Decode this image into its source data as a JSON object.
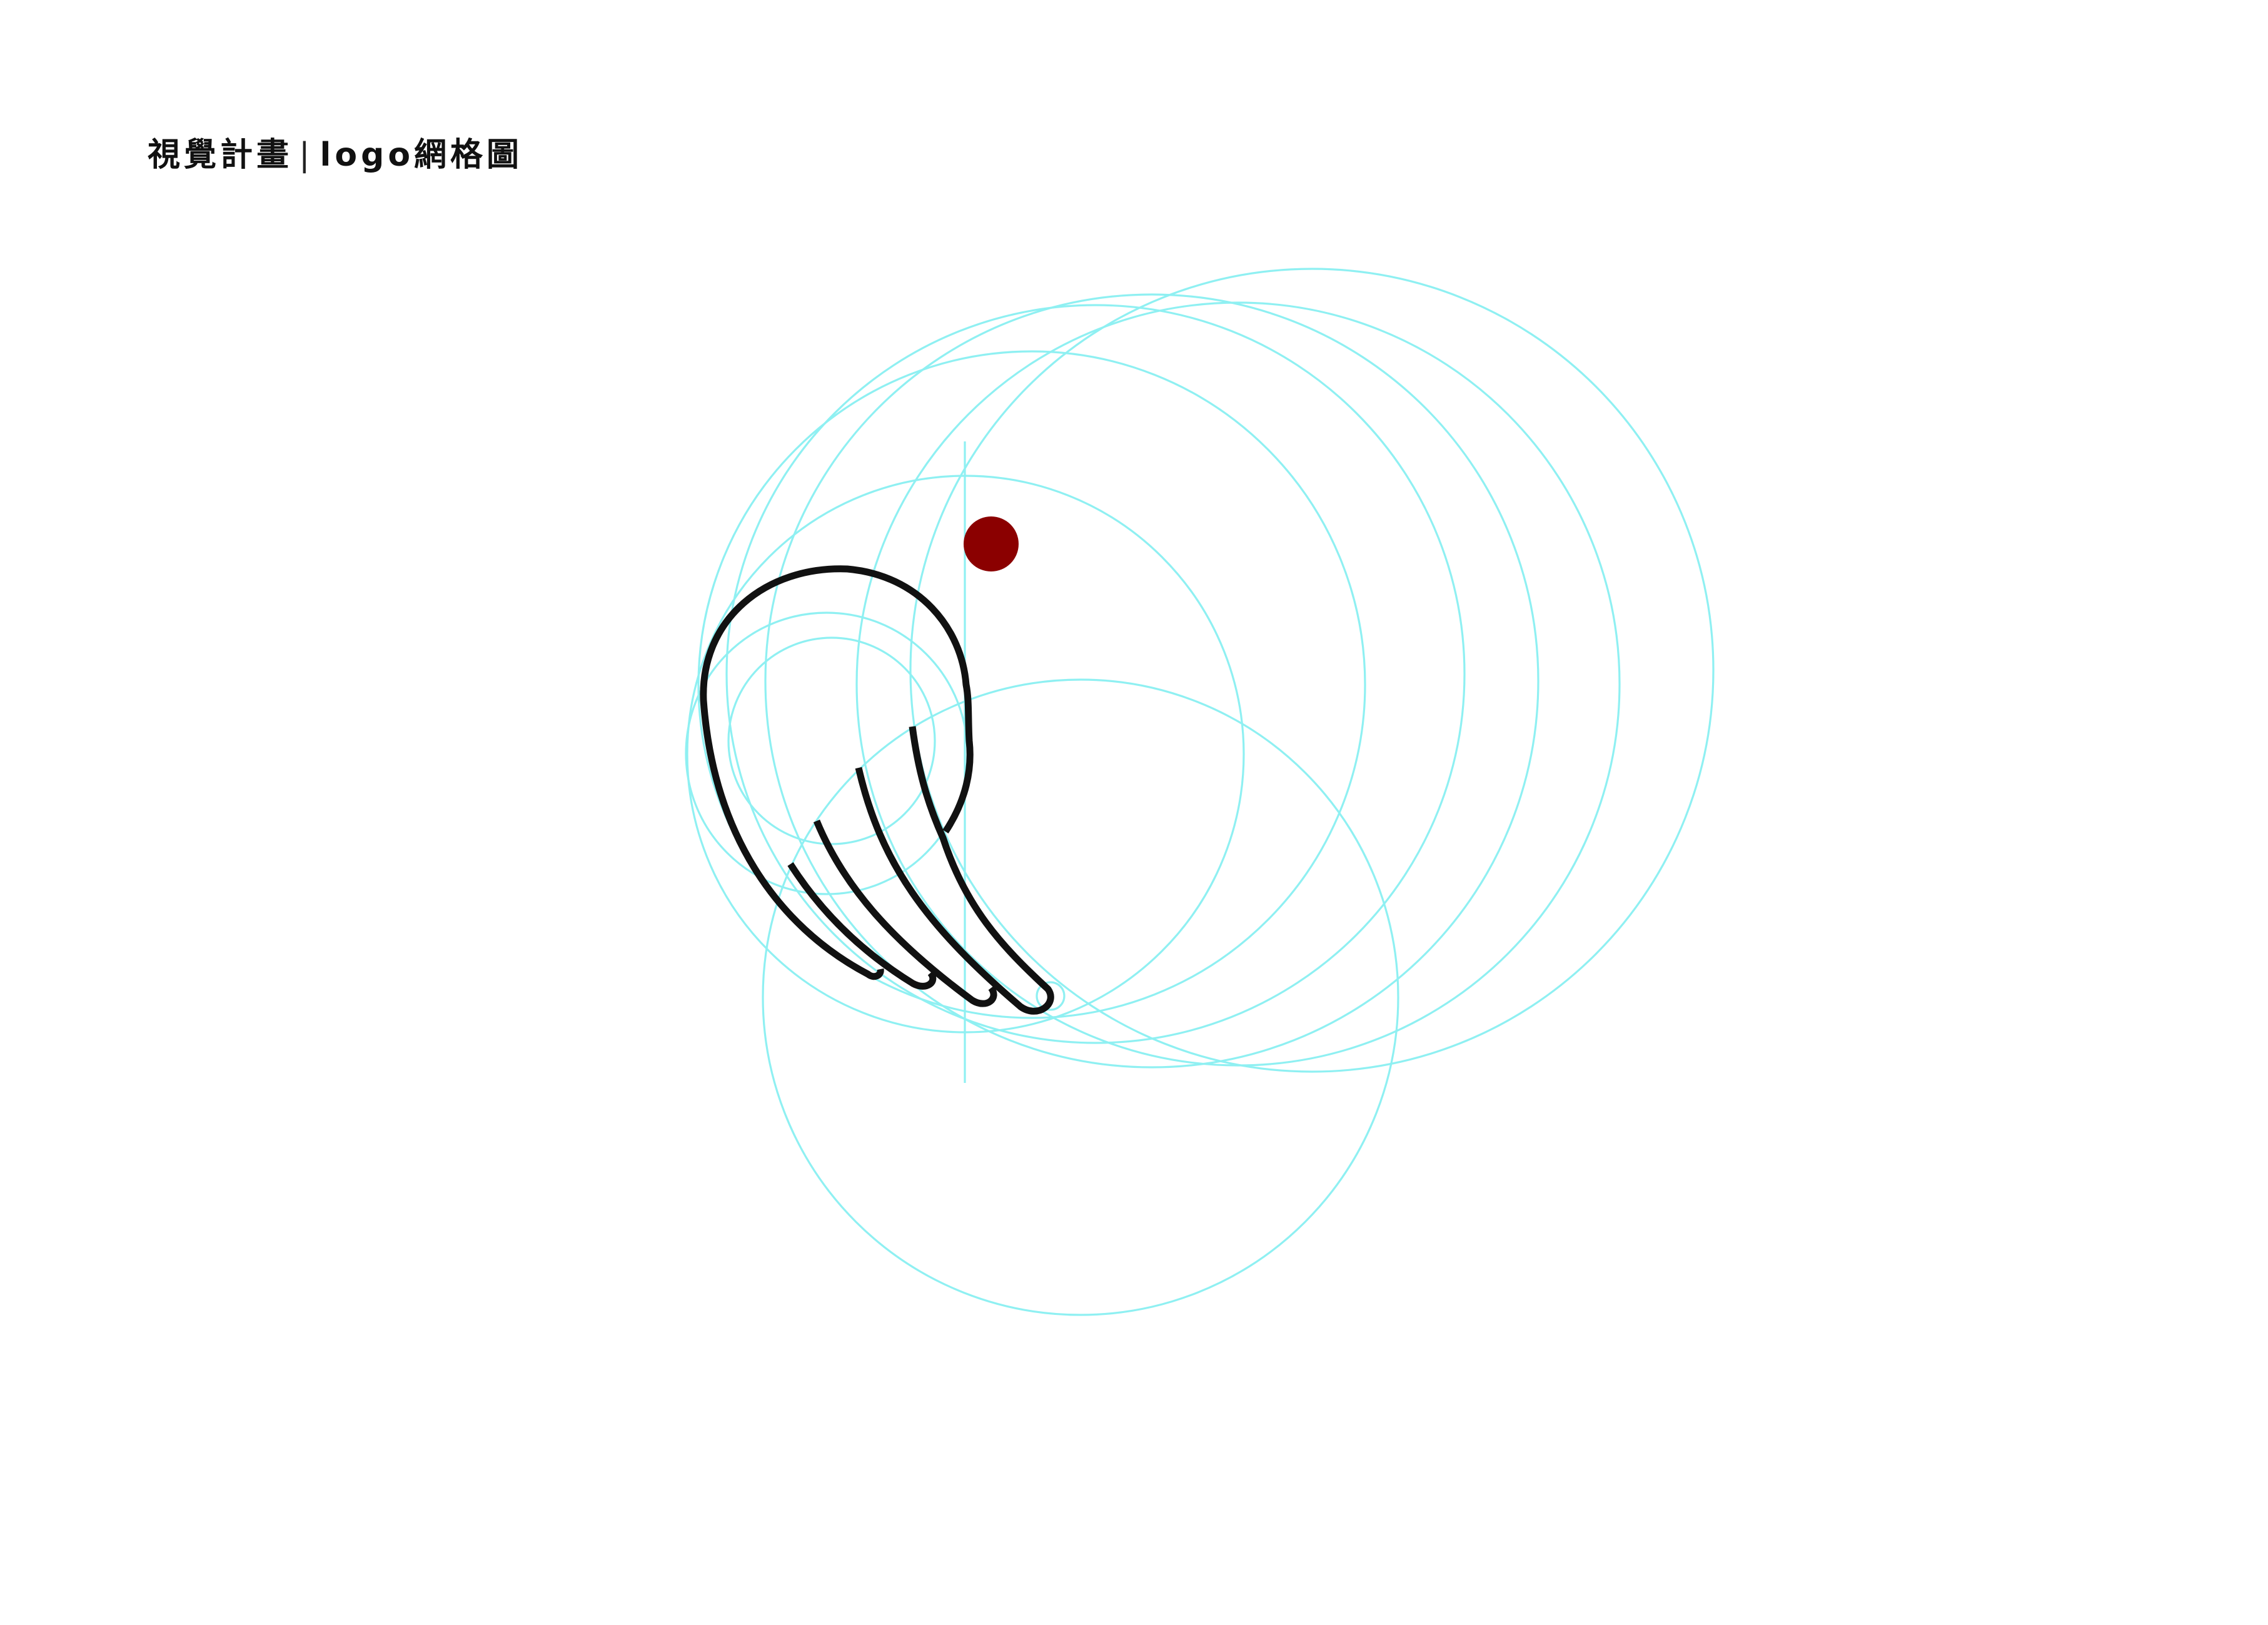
{
  "title": {
    "main": "視覺計畫",
    "separator": "|",
    "sub": "logo網格圖"
  },
  "colors": {
    "background": "#ffffff",
    "grid": "#8ff0f2",
    "logo_stroke": "#111111",
    "dot": "#8b0000"
  }
}
